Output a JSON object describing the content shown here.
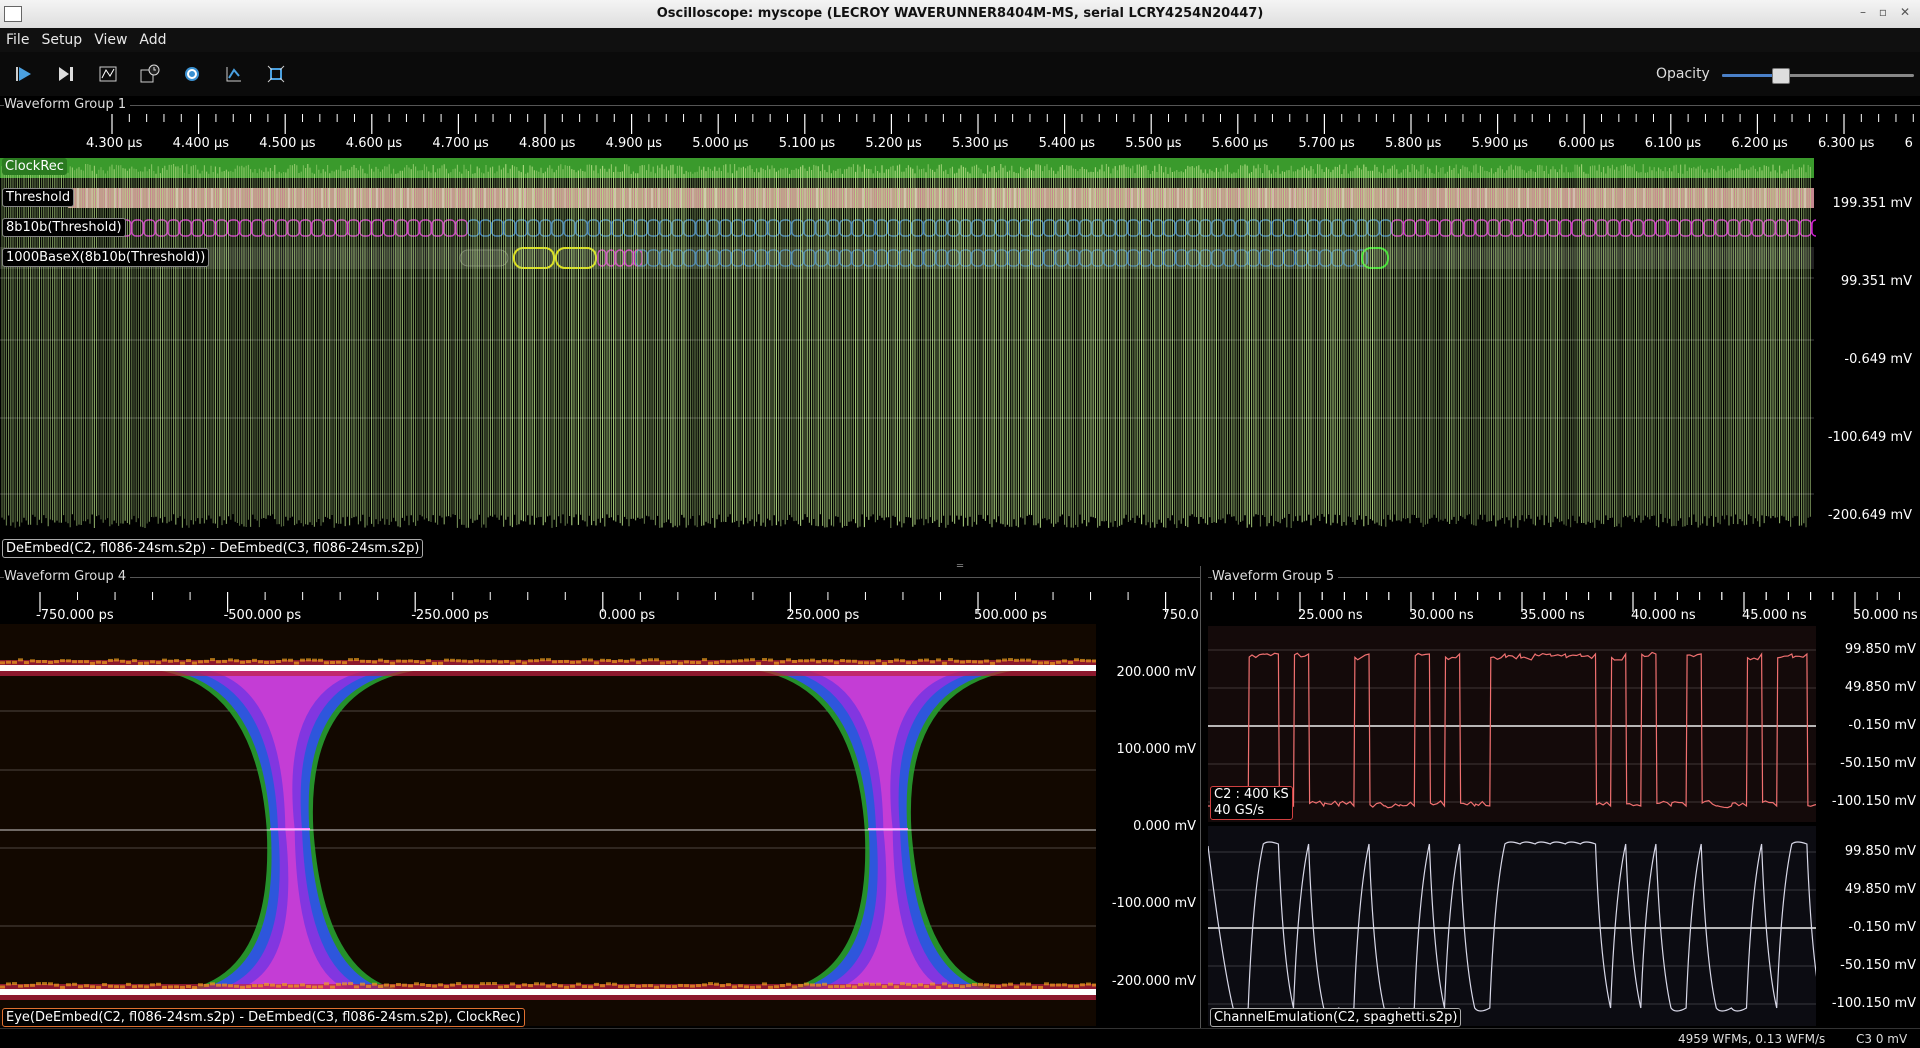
{
  "window": {
    "title": "Oscilloscope: myscope (LECROY WAVERUNNER8404M-MS, serial LCRY4254N20447)",
    "min_glyph": "–",
    "max_glyph": "▫",
    "close_glyph": "✕"
  },
  "menu": [
    "File",
    "Setup",
    "View",
    "Add"
  ],
  "toolbar": {
    "buttons": [
      "play-icon",
      "single-step-icon",
      "stop-trigger-icon",
      "history-icon",
      "refresh-icon",
      "autoscale-icon",
      "fullscreen-icon"
    ],
    "opacity_label": "Opacity",
    "opacity_value": 0.3
  },
  "group1": {
    "title": "Waveform Group 1",
    "time_ticks": [
      "4.300 µs",
      "4.400 µs",
      "4.500 µs",
      "4.600 µs",
      "4.700 µs",
      "4.800 µs",
      "4.900 µs",
      "5.000 µs",
      "5.100 µs",
      "5.200 µs",
      "5.300 µs",
      "5.400 µs",
      "5.500 µs",
      "5.600 µs",
      "5.700 µs",
      "5.800 µs",
      "5.900 µs",
      "6.000 µs",
      "6.100 µs",
      "6.200 µs",
      "6.300 µs",
      "6"
    ],
    "volt_ticks": [
      "199.351 mV",
      "99.351 mV",
      "-0.649 mV",
      "-100.649 mV",
      "-200.649 mV"
    ],
    "decodes": [
      "ClockRec",
      "Threshold",
      "8b10b(Threshold)",
      "1000BaseX(8b10b(Threshold))"
    ],
    "waveform_label": "DeEmbed(C2, fl086-24sm.s2p) - DeEmbed(C3, fl086-24sm.s2p)",
    "colors": {
      "clockrec": "#3a9a2c",
      "threshold": "#e8a0a8",
      "decode8b10b_a": "#d020d0",
      "decode8b10b_b": "#3070c0",
      "waveform": "#b8e088"
    }
  },
  "group4": {
    "title": "Waveform Group 4",
    "time_ticks": [
      "-750.000 ps",
      "-500.000 ps",
      "-250.000 ps",
      "0.000 ps",
      "250.000 ps",
      "500.000 ps",
      "750.0"
    ],
    "volt_ticks": [
      "200.000 mV",
      "100.000 mV",
      "0.000 mV",
      "-100.000 mV",
      "-200.000 mV"
    ],
    "waveform_label": "Eye(DeEmbed(C2, fl086-24sm.s2p) - DeEmbed(C3, fl086-24sm.s2p), ClockRec)"
  },
  "group5": {
    "title": "Waveform Group 5",
    "time_ticks": [
      "25.000 ns",
      "30.000 ns",
      "35.000 ns",
      "40.000 ns",
      "45.000 ns",
      "50.000 ns"
    ],
    "volt_ticks_top": [
      "99.850 mV",
      "49.850 mV",
      "-0.150 mV",
      "-50.150 mV",
      "-100.150 mV"
    ],
    "volt_ticks_bottom": [
      "99.850 mV",
      "49.850 mV",
      "-0.150 mV",
      "-50.150 mV",
      "-100.150 mV"
    ],
    "c2_info_line1": "C2 : 400 kS",
    "c2_info_line2": "40 GS/s",
    "waveform_label": "ChannelEmulation(C2, spaghetti.s2p)",
    "colors": {
      "c2": "#f07070",
      "emul": "#d8d8e8"
    }
  },
  "status": {
    "rate": "4959 WFMs, 0.13 WFM/s",
    "channel": "C3 0 mV"
  }
}
